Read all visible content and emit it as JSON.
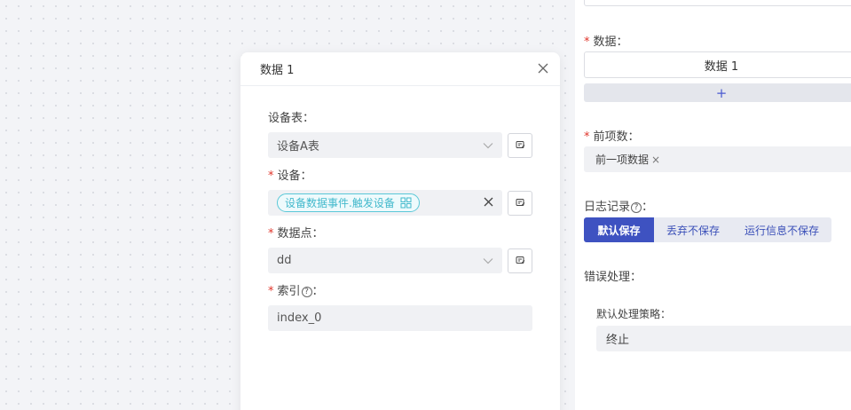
{
  "modal": {
    "title": "数据 1",
    "fields": {
      "device_table": {
        "label": "设备表：",
        "value": "设备A表"
      },
      "device": {
        "required": "*",
        "label": "设备：",
        "tag": "设备数据事件.触发设备"
      },
      "datapoint": {
        "required": "*",
        "label": "数据点：",
        "value": "dd"
      },
      "index": {
        "required": "*",
        "label": "索引",
        "help": "?",
        "colon": "：",
        "value": "index_0"
      }
    }
  },
  "panel": {
    "data": {
      "required": "*",
      "label": "数据：",
      "item": "数据 1",
      "add": "+"
    },
    "prev": {
      "required": "*",
      "label": "前项数：",
      "tag": "前一项数据",
      "tag_close": "×"
    },
    "log": {
      "label": "日志记录",
      "help": "?",
      "colon": "：",
      "options": [
        "默认保存",
        "丢弃不保存",
        "运行信息不保存"
      ]
    },
    "error": {
      "label": "错误处理：",
      "strategy_label": "默认处理策略：",
      "strategy_value": "终止"
    }
  }
}
